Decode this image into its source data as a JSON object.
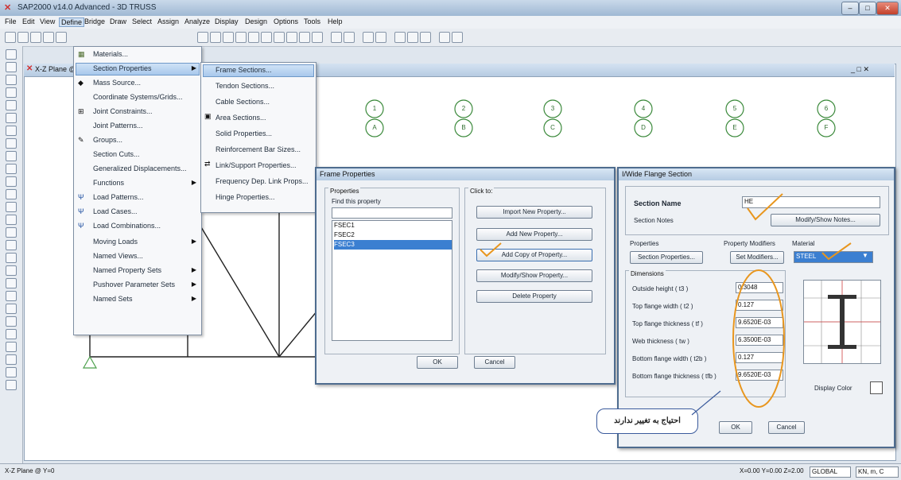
{
  "window": {
    "title": "SAP2000 v14.0 Advanced - 3D TRUSS",
    "minimize": "–",
    "maximize": "□",
    "close": "✕"
  },
  "menubar": [
    "File",
    "Edit",
    "View",
    "Define",
    "Bridge",
    "Draw",
    "Select",
    "Assign",
    "Analyze",
    "Display",
    "Design",
    "Options",
    "Tools",
    "Help"
  ],
  "toolbar_icons": [
    "new-icon",
    "open-icon",
    "save-icon",
    "undo-icon",
    "redo-icon"
  ],
  "workspace": {
    "title": "X-Z Plane @ Y=0",
    "win_controls": "_ □ ✕",
    "grid_bubbles_top": [
      "1",
      "2",
      "3",
      "4",
      "5",
      "6"
    ],
    "grid_bubbles_bottom": [
      "A",
      "B",
      "C",
      "D",
      "E",
      "F"
    ]
  },
  "define_menu": {
    "items": [
      {
        "label": "Materials...",
        "icon": "materials-icon"
      },
      {
        "label": "Section Properties",
        "submenu": true
      },
      {
        "label": "Mass Source..."
      },
      {
        "label": "Coordinate Systems/Grids..."
      },
      {
        "label": "Joint Constraints..."
      },
      {
        "label": "Joint Patterns..."
      },
      {
        "label": "Groups..."
      },
      {
        "label": "Section Cuts..."
      },
      {
        "label": "Generalized Displacements..."
      },
      {
        "label": "Functions",
        "submenu": true
      },
      {
        "label": "Load Patterns..."
      },
      {
        "label": "Load Cases..."
      },
      {
        "label": "Load Combinations..."
      },
      {
        "label": "Moving Loads",
        "submenu": true
      },
      {
        "label": "Named Views..."
      },
      {
        "label": "Named Property Sets",
        "submenu": true
      },
      {
        "label": "Pushover Parameter Sets",
        "submenu": true
      },
      {
        "label": "Named Sets",
        "submenu": true
      }
    ]
  },
  "section_submenu": {
    "items": [
      "Frame Sections...",
      "Tendon Sections...",
      "Cable Sections...",
      "Area Sections...",
      "Solid Properties...",
      "Reinforcement Bar Sizes...",
      "Link/Support Properties...",
      "Frequency Dep. Link Props...",
      "Hinge Properties..."
    ]
  },
  "frame_properties": {
    "title": "Frame Properties",
    "properties_label": "Properties",
    "find_label": "Find this property",
    "list": [
      "FSEC1",
      "FSEC2",
      "FSEC3"
    ],
    "click_to_label": "Click to:",
    "buttons": [
      "Import New Property...",
      "Add New Property...",
      "Add Copy of Property...",
      "Modify/Show Property...",
      "Delete Property"
    ],
    "ok": "OK",
    "cancel": "Cancel"
  },
  "iwide_flange": {
    "title": "I/Wide Flange Section",
    "section_name_label": "Section Name",
    "section_name_value": "HE",
    "section_notes_label": "Section Notes",
    "modify_notes_button": "Modify/Show Notes...",
    "properties_label": "Properties",
    "section_properties_button": "Section Properties...",
    "modifiers_label": "Property Modifiers",
    "set_modifiers_button": "Set Modifiers...",
    "material_label": "Material",
    "material_value": "STEEL",
    "dimensions_label": "Dimensions",
    "dimensions": [
      {
        "label": "Outside height  ( t3 )",
        "value": "0.3048"
      },
      {
        "label": "Top flange width  ( t2 )",
        "value": "0.127"
      },
      {
        "label": "Top flange thickness  ( tf )",
        "value": "9.6520E-03"
      },
      {
        "label": "Web thickness  ( tw )",
        "value": "6.3500E-03"
      },
      {
        "label": "Bottom flange width  ( t2b )",
        "value": "0.127"
      },
      {
        "label": "Bottom flange thickness  ( tfb )",
        "value": "9.6520E-03"
      }
    ],
    "display_color_label": "Display Color",
    "ok": "OK",
    "cancel": "Cancel"
  },
  "annotation": {
    "callout": "احتیاج به تغییر ندارند",
    "accent_color": "#e8961e"
  },
  "statusbar": {
    "left": "X-Z Plane @ Y=0",
    "coords": "X=0.00 Y=0.00 Z=2.00",
    "units_label": "GLOBAL",
    "units": "KN, m, C"
  }
}
